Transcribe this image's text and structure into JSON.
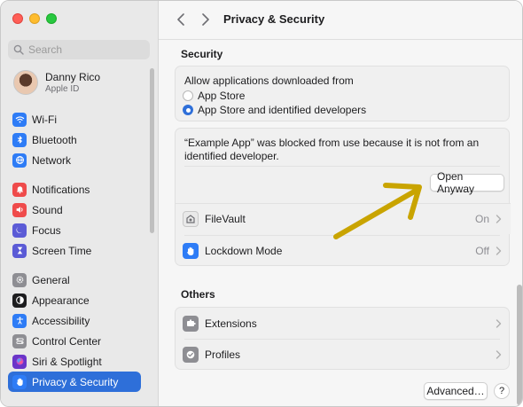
{
  "sidebar": {
    "search_placeholder": "Search",
    "account": {
      "name": "Danny Rico",
      "subtitle": "Apple ID"
    },
    "groups": [
      [
        {
          "label": "Wi‑Fi",
          "icon": "wifi-icon",
          "color": "#2e7cf6"
        },
        {
          "label": "Bluetooth",
          "icon": "bluetooth-icon",
          "color": "#2e7cf6"
        },
        {
          "label": "Network",
          "icon": "globe-icon",
          "color": "#2e7cf6"
        }
      ],
      [
        {
          "label": "Notifications",
          "icon": "bell-icon",
          "color": "#ef4b4b"
        },
        {
          "label": "Sound",
          "icon": "speaker-icon",
          "color": "#ef4b4b"
        },
        {
          "label": "Focus",
          "icon": "moon-icon",
          "color": "#5b5bd6"
        },
        {
          "label": "Screen Time",
          "icon": "hourglass-icon",
          "color": "#5b5bd6"
        }
      ],
      [
        {
          "label": "General",
          "icon": "gear-icon",
          "color": "#8e8e93"
        },
        {
          "label": "Appearance",
          "icon": "appearance-icon",
          "color": "#1d1d1f"
        },
        {
          "label": "Accessibility",
          "icon": "accessibility-icon",
          "color": "#2e7cf6"
        },
        {
          "label": "Control Center",
          "icon": "control-center-icon",
          "color": "#8e8e93"
        },
        {
          "label": "Siri & Spotlight",
          "icon": "siri-icon",
          "color": "#6a35c9"
        },
        {
          "label": "Privacy & Security",
          "icon": "hand-icon",
          "color": "#2e7cf6",
          "active": true
        }
      ]
    ]
  },
  "header": {
    "title": "Privacy & Security"
  },
  "security": {
    "section_title": "Security",
    "allow_label": "Allow applications downloaded from",
    "options": [
      {
        "label": "App Store",
        "selected": false
      },
      {
        "label": "App Store and identified developers",
        "selected": true
      }
    ],
    "blocked_line1": "“Example App” was blocked from use because it is not from an",
    "blocked_line2": "identified developer.",
    "open_anyway": "Open Anyway",
    "rows": [
      {
        "label": "FileVault",
        "value": "On",
        "icon": "filevault-icon"
      },
      {
        "label": "Lockdown Mode",
        "value": "Off",
        "icon": "lockdown-hand-icon"
      }
    ]
  },
  "others": {
    "section_title": "Others",
    "rows": [
      {
        "label": "Extensions",
        "icon": "extensions-icon"
      },
      {
        "label": "Profiles",
        "icon": "profiles-icon"
      }
    ]
  },
  "footer": {
    "advanced_label": "Advanced…",
    "help_label": "?"
  },
  "colors": {
    "accent": "#2e6fd9",
    "annotation_arrow": "#c9a400"
  }
}
